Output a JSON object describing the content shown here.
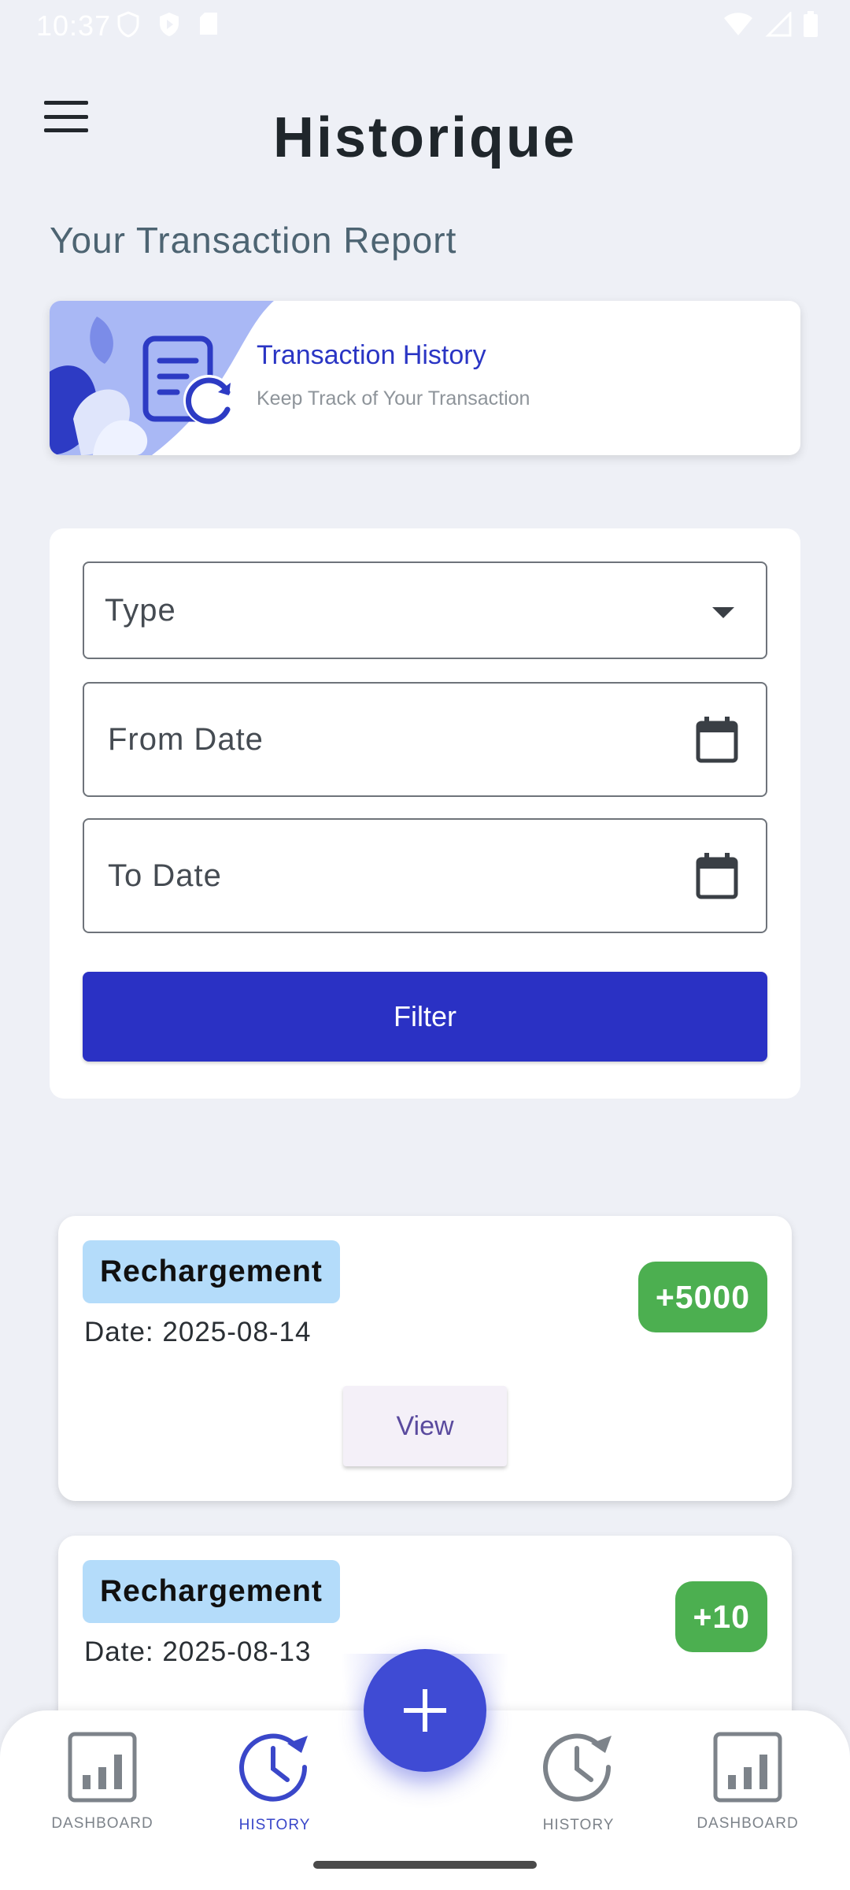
{
  "status_bar": {
    "time": "10:37",
    "left_icons": [
      "shield-icon",
      "play-protect-icon",
      "sd-card-icon"
    ],
    "right_icons": [
      "wifi-icon",
      "signal-icon",
      "battery-icon"
    ]
  },
  "header": {
    "menu_icon": "hamburger-menu-icon",
    "title": "Historique"
  },
  "section_title": "Your Transaction Report",
  "banner": {
    "icon": "document-refresh-icon",
    "title": "Transaction History",
    "subtitle": "Keep Track of Your Transaction"
  },
  "filter": {
    "type_placeholder": "Type",
    "from_date_placeholder": "From Date",
    "to_date_placeholder": "To Date",
    "button_label": "Filter"
  },
  "transactions": [
    {
      "type": "Rechargement",
      "date_label": "Date:",
      "date": "2025-08-14",
      "amount": "+5000",
      "view_label": "View"
    },
    {
      "type": "Rechargement",
      "date_label": "Date:",
      "date": "2025-08-13",
      "amount": "+10"
    }
  ],
  "bottom_nav": {
    "items": [
      {
        "label": "DASHBOARD",
        "icon": "bar-chart-icon",
        "active": false
      },
      {
        "label": "HISTORY",
        "icon": "history-icon",
        "active": true
      },
      {
        "label": "HISTORY",
        "icon": "history-icon",
        "active": false
      },
      {
        "label": "DASHBOARD",
        "icon": "bar-chart-icon",
        "active": false
      }
    ],
    "fab_icon": "plus-icon"
  },
  "colors": {
    "primary": "#2a31c4",
    "accent_blue": "#3f4bd4",
    "amount_green": "#4caf50",
    "type_badge": "#b4dcfa",
    "background": "#eef0f6"
  }
}
